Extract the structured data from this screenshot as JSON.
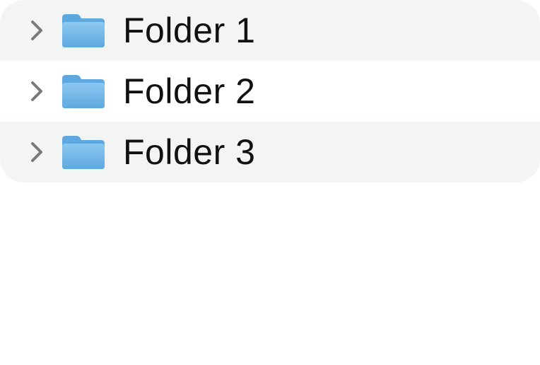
{
  "folders": [
    {
      "label": "Folder 1",
      "chevron_icon": "chevron-right-icon",
      "icon": "folder-icon"
    },
    {
      "label": "Folder 2",
      "chevron_icon": "chevron-right-icon",
      "icon": "folder-icon"
    },
    {
      "label": "Folder 3",
      "chevron_icon": "chevron-right-icon",
      "icon": "folder-icon"
    }
  ],
  "colors": {
    "row_alt_background": "#f3f4f4",
    "row_background": "#ffffff",
    "folder_blue": "#6db5e8",
    "chevron_gray": "#7a7a7a",
    "text": "#111111"
  }
}
